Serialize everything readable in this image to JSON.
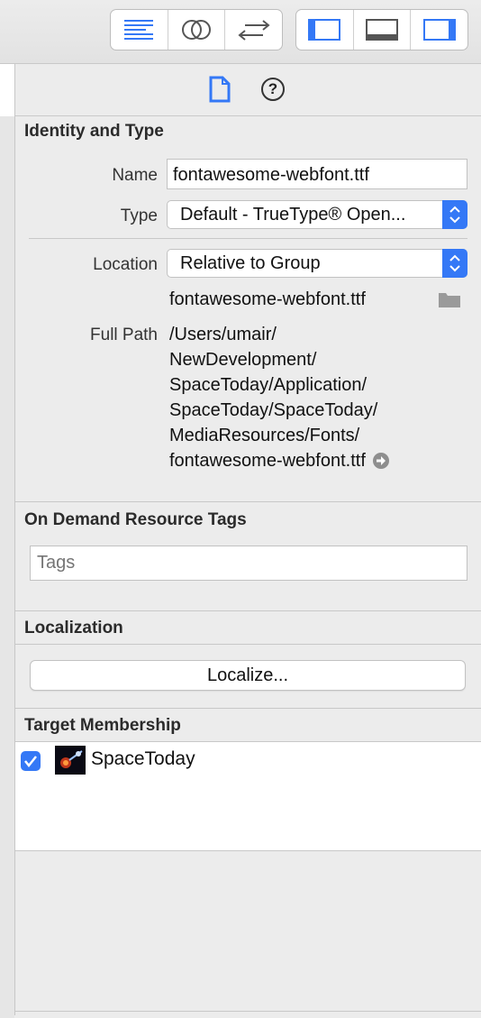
{
  "toolbar": {
    "editor_icons": [
      "standard-editor-icon",
      "assistant-editor-icon",
      "version-editor-icon"
    ],
    "view_icons": [
      "navigator-toggle-icon",
      "debug-area-toggle-icon",
      "utilities-toggle-icon"
    ]
  },
  "inspector_tabs": {
    "file_icon": "file-inspector-icon",
    "help_icon": "quick-help-icon",
    "help_glyph": "?"
  },
  "identity": {
    "title": "Identity and Type",
    "name_label": "Name",
    "name_value": "fontawesome-webfont.ttf",
    "type_label": "Type",
    "type_value": "Default - TrueType® Open...",
    "location_label": "Location",
    "location_value": "Relative to Group",
    "file_name": "fontawesome-webfont.ttf",
    "full_path_label": "Full Path",
    "full_path_lines": [
      "/Users/umair/",
      "NewDevelopment/",
      "SpaceToday/Application/",
      "SpaceToday/SpaceToday/",
      "MediaResources/Fonts/",
      "fontawesome-webfont.ttf"
    ]
  },
  "tags": {
    "title": "On Demand Resource Tags",
    "placeholder": "Tags"
  },
  "localization": {
    "title": "Localization",
    "button_label": "Localize..."
  },
  "target_membership": {
    "title": "Target Membership",
    "targets": [
      {
        "name": "SpaceToday",
        "checked": true
      }
    ]
  },
  "colors": {
    "accent": "#3478f6"
  }
}
